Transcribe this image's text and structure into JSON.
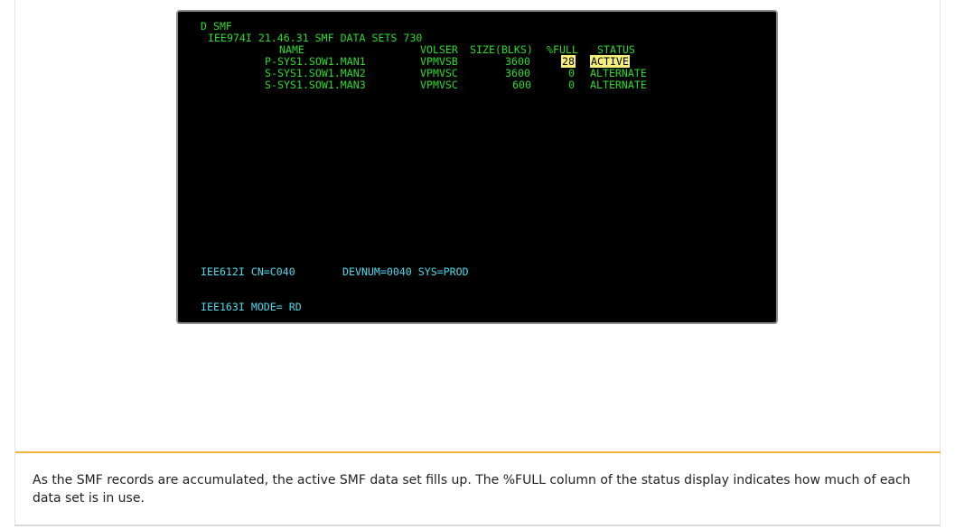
{
  "terminal": {
    "command": "D SMF",
    "header": "IEE974I 21.46.31 SMF DATA SETS 730",
    "columns": {
      "name": "NAME",
      "volser": "VOLSER",
      "size": "SIZE(BLKS)",
      "full": "%FULL",
      "status": "STATUS"
    },
    "rows": [
      {
        "name": "P-SYS1.SOW1.MAN1",
        "volser": "VPMVSB",
        "size": "3600",
        "full": "28",
        "status": "ACTIVE"
      },
      {
        "name": "S-SYS1.SOW1.MAN2",
        "volser": "VPMVSC",
        "size": "3600",
        "full": "0",
        "status": "ALTERNATE"
      },
      {
        "name": "S-SYS1.SOW1.MAN3",
        "volser": "VPMVSC",
        "size": "600",
        "full": "0",
        "status": "ALTERNATE"
      }
    ],
    "footer1_msg": "IEE612I CN=C040",
    "footer1_dev": "DEVNUM=0040 SYS=PROD",
    "footer2_msg": "IEE163I MODE= RD"
  },
  "caption": "As the SMF records are accumulated, the active SMF data set fills up. The %FULL column of the status display indicates how much of each data set is in use."
}
